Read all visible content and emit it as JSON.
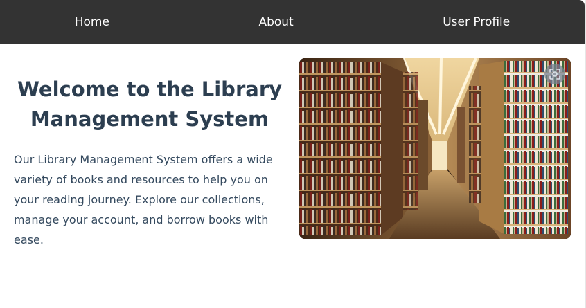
{
  "nav": {
    "items": [
      {
        "label": "Home"
      },
      {
        "label": "About"
      },
      {
        "label": "User Profile"
      }
    ]
  },
  "hero": {
    "title": "Welcome to the Library Management System",
    "description": "Our Library Management System offers a wide variety of books and resources to help you on your reading journey. Explore our collections, manage your account, and borrow books with ease.",
    "image_alt": "Library bookshelves",
    "image_action_icon": "visual-search-icon"
  },
  "colors": {
    "navbar_bg": "#333333",
    "nav_text": "#ffffff",
    "title": "#2c3e50",
    "body_text": "#34495e"
  }
}
